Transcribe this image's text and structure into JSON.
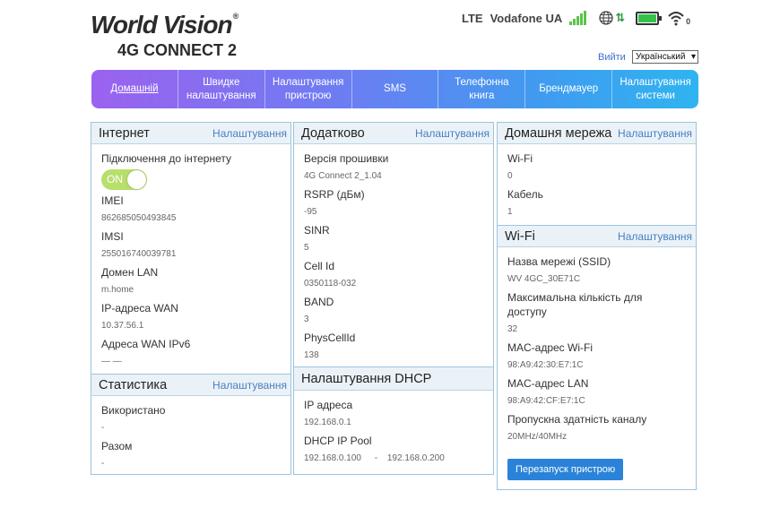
{
  "logo": {
    "brand": "World Vision",
    "model": "4G CONNECT 2"
  },
  "status": {
    "network": "LTE",
    "operator": "Vodafone UA",
    "wifi_clients": "0"
  },
  "header": {
    "logout": "Вийти",
    "language": "Український"
  },
  "nav": [
    {
      "label": "Домашній"
    },
    {
      "label": "Швидке налаштування"
    },
    {
      "label": "Налаштування пристрою"
    },
    {
      "label": "SMS"
    },
    {
      "label": "Телефонна книга"
    },
    {
      "label": "Брендмауер"
    },
    {
      "label": "Налаштування системи"
    }
  ],
  "internet": {
    "title": "Інтернет",
    "settings": "Налаштування",
    "connection_label": "Підключення до інтернету",
    "toggle": "ON",
    "imei_label": "IMEI",
    "imei": "862685050493845",
    "imsi_label": "IMSI",
    "imsi": "255016740039781",
    "domain_label": "Домен LAN",
    "domain": "m.home",
    "wan_ip_label": "IP-адреса WAN",
    "wan_ip": "10.37.56.1",
    "wan_ipv6_label": "Адреса WAN IPv6",
    "wan_ipv6": "— —"
  },
  "stats": {
    "title": "Статистика",
    "settings": "Налаштування",
    "used_label": "Використано",
    "used": "-",
    "total_label": "Разом",
    "total": "-"
  },
  "extra": {
    "title": "Додатково",
    "settings": "Налаштування",
    "fw_label": "Версія прошивки",
    "fw": "4G Connect 2_1.04",
    "rsrp_label": "RSRP (дБм)",
    "rsrp": "-95",
    "sinr_label": "SINR",
    "sinr": "5",
    "cell_label": "Cell Id",
    "cell": "0350118-032",
    "band_label": "BAND",
    "band": "3",
    "phys_label": "PhysCellId",
    "phys": "138"
  },
  "dhcp": {
    "title": "Налаштування DHCP",
    "ip_label": "IP адреса",
    "ip": "192.168.0.1",
    "pool_label": "DHCP IP Pool",
    "pool_start": "192.168.0.100",
    "pool_dash": "-",
    "pool_end": "192.168.0.200"
  },
  "home": {
    "title": "Домашня мережа",
    "settings": "Налаштування",
    "wifi_label": "Wi-Fi",
    "wifi": "0",
    "cable_label": "Кабель",
    "cable": "1"
  },
  "wifi": {
    "title": "Wi-Fi",
    "settings": "Налаштування",
    "ssid_label": "Назва мережі (SSID)",
    "ssid": "WV 4GC_30E71C",
    "max_label": "Максимальна кількість для доступу",
    "max": "32",
    "mac_wifi_label": "MAC-адрес Wi-Fi",
    "mac_wifi": "98:A9:42:30:E7:1C",
    "mac_lan_label": "MAC-адрес LAN",
    "mac_lan": "98:A9:42:CF:E7:1C",
    "bw_label": "Пропускна здатність каналу",
    "bw": "20MHz/40MHz",
    "restart": "Перезапуск пристрою"
  },
  "colors": {
    "accent": "#2a83d8",
    "link": "#4a7ec0",
    "toggle_on": "#b7df6b",
    "nav_start": "#9b62f0",
    "nav_end": "#2fb4f0"
  }
}
